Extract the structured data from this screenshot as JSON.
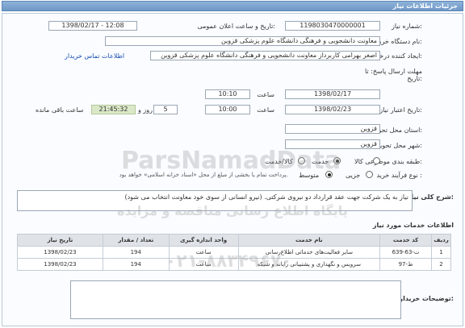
{
  "header": {
    "title": "جزئیات اطلاعات نیاز"
  },
  "form": {
    "need_number_label": "شماره نیاز:",
    "need_number": "1198030470000001",
    "announce_label": "تاریخ و ساعت اعلان عمومی:",
    "announce_value": "1398/02/17 - 12:08",
    "buyer_label": "نام دستگاه خریدار:",
    "buyer_value": "معاونت دانشجویی و فرهنگی دانشگاه علوم پزشکی قزوین",
    "creator_label": "ایجاد کننده درخواست:",
    "creator_value": "اصغر بهرامی کاربرداز معاونت دانشجویی و فرهنگی دانشگاه علوم پزشکی قزوین",
    "contact_link": "اطلاعات تماس خریدار",
    "response_deadline_label": "مهلت ارسال پاسخ: تا تاریخ:",
    "response_date": "1398/02/17",
    "time_label": "ساعت",
    "response_time": "10:10",
    "validity_label": "تاریخ اعتبار نیاز:",
    "validity_date": "1398/02/23",
    "validity_time": "10:00",
    "days_value": "5",
    "days_label": "روز و",
    "remaining_time": "21:45:32",
    "remaining_label": "ساعت باقی مانده",
    "province_label": "استان محل تحویل:",
    "province_value": "قزوین",
    "city_label": "شهر محل تحویل:",
    "city_value": "قزوین",
    "category_label": "طبقه بندی موضوعی:",
    "category_options": [
      "کالا",
      "خدمت",
      "کالا/خدمت"
    ],
    "category_selected": "خدمت",
    "process_label": "نوع فرآیند خرید :",
    "process_options": [
      "متوسط",
      "جزیی"
    ],
    "process_selected": "متوسط",
    "process_note": "پرداخت تمام یا بخشی از مبلغ از محل «اسناد خزانه اسلامی» خواهد بود."
  },
  "description": {
    "label": "شرح کلی نیاز:",
    "text": "نیاز به یک شرکت جهت عقد قرارداد دو نیروی شرکتی. (نیرو انسانی از سوی خود معاونت انتخاب می شود)"
  },
  "services": {
    "section_title": "اطلاعات خدمات مورد نیاز",
    "columns": [
      "ردیف",
      "کد خدمت",
      "نام خدمت",
      "واحد اندازه گیری",
      "تعداد / مقدار",
      "تاریخ نیاز"
    ],
    "rows": [
      [
        "1",
        "ت-63-639",
        "سایر فعالیت‌های خدماتی اطلاع‌رسانی",
        "ساعت",
        "194",
        "1398/02/23"
      ],
      [
        "2",
        "ط-97",
        "سرویس و نگهداری و پشتیبانی رایانه و شبکه",
        "ساعت",
        "194",
        "1398/02/23"
      ]
    ]
  },
  "notes": {
    "label": "توضیحات خریدار:",
    "value": ""
  },
  "watermark": {
    "brand": "ParsNamadData",
    "line2": "پایگاه اطلاع رسانی مناقصه و مزایده",
    "phone": "۰۲۱-۸۸۳۴۹۶۷۰"
  }
}
